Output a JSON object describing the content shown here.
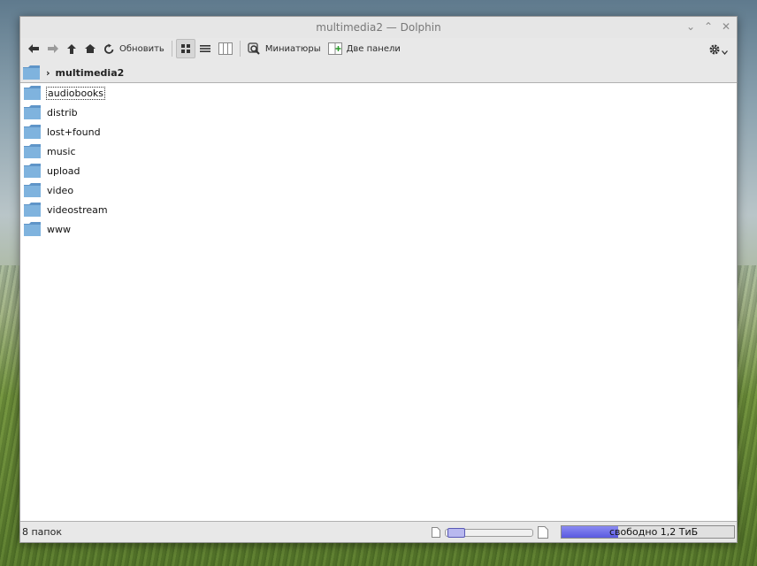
{
  "window": {
    "title": "multimedia2 — Dolphin"
  },
  "toolbar": {
    "refresh_label": "Обновить",
    "previews_label": "Миниатюры",
    "split_label": "Две панели"
  },
  "location": {
    "folder": "multimedia2"
  },
  "files": [
    {
      "name": "audiobooks",
      "icon": "folder-icon"
    },
    {
      "name": "distrib",
      "icon": "folder-icon"
    },
    {
      "name": "lost+found",
      "icon": "folder-icon"
    },
    {
      "name": "music",
      "icon": "folder-icon"
    },
    {
      "name": "upload",
      "icon": "folder-icon"
    },
    {
      "name": "video",
      "icon": "folder-icon"
    },
    {
      "name": "videostream",
      "icon": "folder-icon"
    },
    {
      "name": "www",
      "icon": "folder-icon"
    }
  ],
  "status": {
    "count_text": "8 папок",
    "free_space_text": "свободно 1,2 ТиБ",
    "free_space_used_fraction": 0.33
  },
  "colors": {
    "folder": "#7fb3de",
    "accent": "#6a6ae8"
  }
}
